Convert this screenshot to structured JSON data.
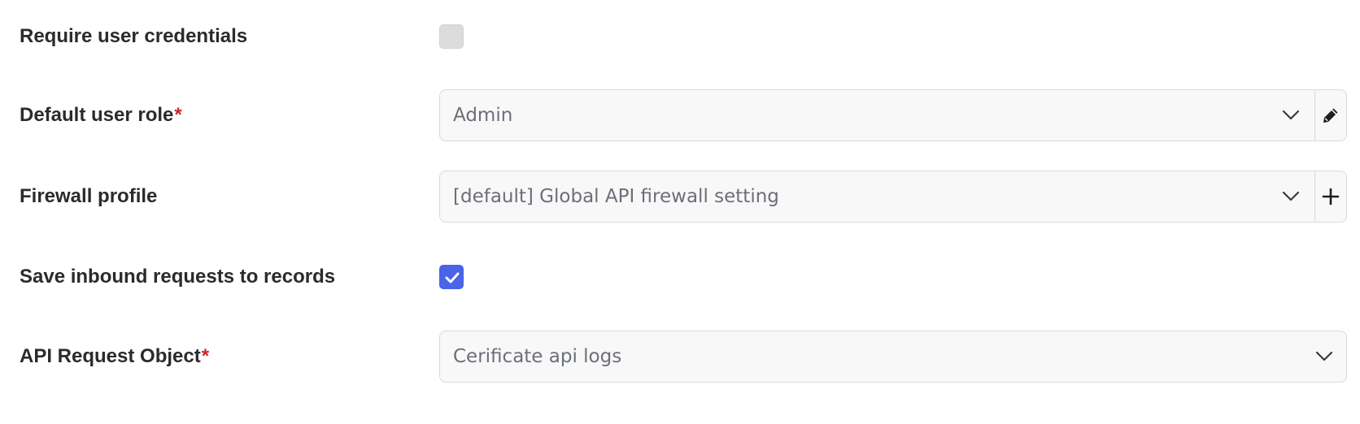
{
  "form": {
    "require_credentials": {
      "label": "Require user credentials",
      "checked": false
    },
    "default_user_role": {
      "label": "Default user role",
      "required_mark": "*",
      "value": "Admin",
      "addon_icon": "pencil-icon"
    },
    "firewall_profile": {
      "label": "Firewall profile",
      "value": "[default] Global API firewall setting",
      "addon_icon": "plus-icon"
    },
    "save_inbound": {
      "label": "Save inbound requests to records",
      "checked": true
    },
    "api_request_object": {
      "label": "API Request Object",
      "required_mark": "*",
      "value": "Cerificate api logs"
    }
  },
  "colors": {
    "accent": "#4a63e7",
    "required": "#c62828",
    "label_text": "#2b2b2b",
    "value_text": "#6b6f78",
    "field_bg": "#f8f8f8",
    "field_border": "#dadada"
  }
}
